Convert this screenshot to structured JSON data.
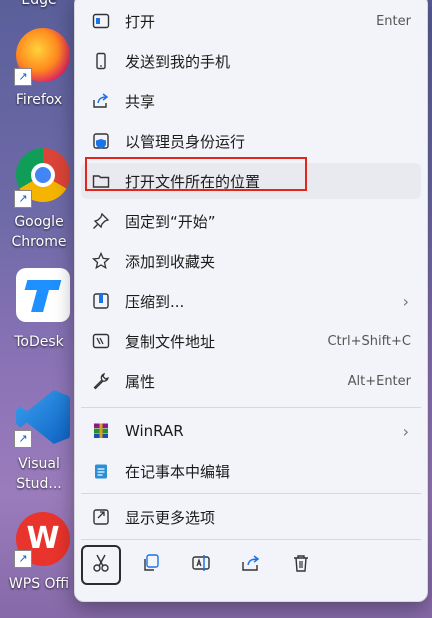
{
  "desktop": {
    "icons": [
      {
        "name": "Edge",
        "label": "Edge"
      },
      {
        "name": "Firefox",
        "label": "Firefox"
      },
      {
        "name": "Google Chrome",
        "label": "Google\nChrome"
      },
      {
        "name": "ToDesk",
        "label": "ToDesk"
      },
      {
        "name": "Visual Studio",
        "label": "Visual\nStud..."
      },
      {
        "name": "WPS Office",
        "label": "WPS Offi"
      }
    ]
  },
  "menu": {
    "items": [
      {
        "label": "打开",
        "shortcut": "Enter",
        "icon": "open-icon"
      },
      {
        "label": "发送到我的手机",
        "icon": "phone-icon"
      },
      {
        "label": "共享",
        "icon": "share-icon"
      },
      {
        "label": "以管理员身份运行",
        "icon": "shield-icon"
      },
      {
        "label": "打开文件所在的位置",
        "icon": "folder-icon"
      },
      {
        "label": "固定到“开始”",
        "icon": "pin-icon"
      },
      {
        "label": "添加到收藏夹",
        "icon": "star-icon"
      },
      {
        "label": "压缩到...",
        "icon": "zip-icon"
      },
      {
        "label": "复制文件地址",
        "shortcut": "Ctrl+Shift+C",
        "icon": "copy-path-icon"
      },
      {
        "label": "属性",
        "shortcut": "Alt+Enter",
        "icon": "wrench-icon"
      },
      {
        "label": "WinRAR",
        "icon": "winrar-icon"
      },
      {
        "label": "在记事本中编辑",
        "icon": "notepad-icon"
      },
      {
        "label": "显示更多选项",
        "icon": "more-options-icon"
      }
    ],
    "highlight_color": "#e3261b"
  },
  "toolbar": {
    "buttons": [
      "cut-icon",
      "copy-icon",
      "rename-icon",
      "share-icon",
      "delete-icon"
    ]
  }
}
